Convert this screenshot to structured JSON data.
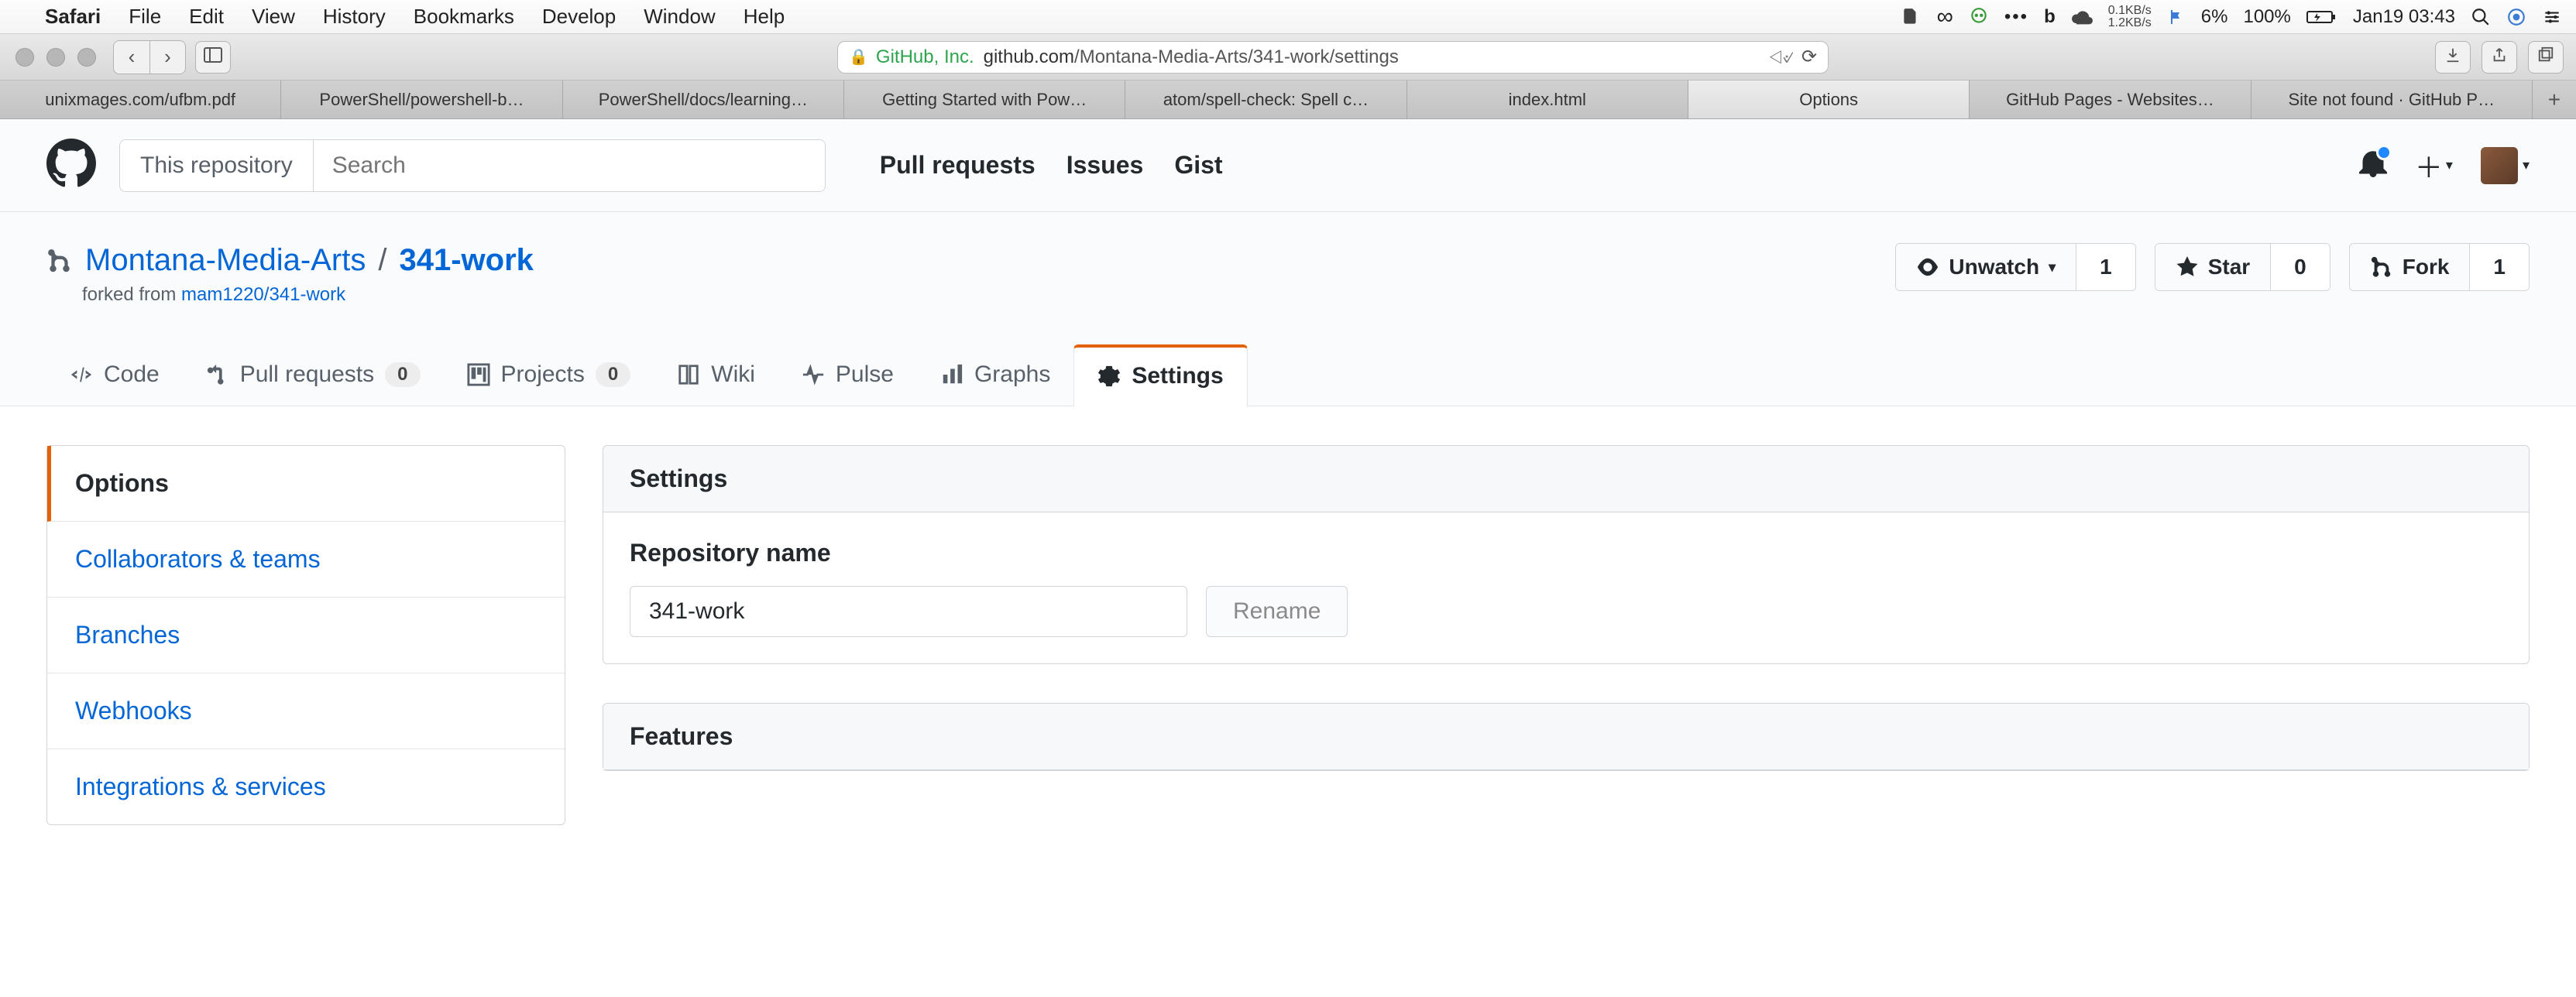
{
  "mac_menubar": {
    "app": "Safari",
    "items": [
      "File",
      "Edit",
      "View",
      "History",
      "Bookmarks",
      "Develop",
      "Window",
      "Help"
    ],
    "net_up": "0.1KB/s",
    "net_down": "1.2KB/s",
    "cpu": "6%",
    "battery": "100%",
    "clock": "Jan19 03:43"
  },
  "safari": {
    "url_prefix_secure": "GitHub, Inc.",
    "url_host": "github.com",
    "url_path": "/Montana-Media-Arts/341-work/settings",
    "tabs": [
      "unixmages.com/ufbm.pdf",
      "PowerShell/powershell-b…",
      "PowerShell/docs/learning…",
      "Getting Started with Pow…",
      "atom/spell-check: Spell c…",
      "index.html",
      "Options",
      "GitHub Pages - Websites…",
      "Site not found · GitHub P…"
    ],
    "active_tab_index": 6
  },
  "github": {
    "search_scope": "This repository",
    "search_placeholder": "Search",
    "nav": [
      "Pull requests",
      "Issues",
      "Gist"
    ]
  },
  "repo": {
    "owner": "Montana-Media-Arts",
    "name": "341-work",
    "forked_prefix": "forked from ",
    "forked_from": "mam1220/341-work",
    "actions": {
      "watch_label": "Unwatch",
      "watch_count": "1",
      "star_label": "Star",
      "star_count": "0",
      "fork_label": "Fork",
      "fork_count": "1"
    },
    "tabs": {
      "code": "Code",
      "pr": "Pull requests",
      "pr_count": "0",
      "projects": "Projects",
      "projects_count": "0",
      "wiki": "Wiki",
      "pulse": "Pulse",
      "graphs": "Graphs",
      "settings": "Settings"
    }
  },
  "sidebar": {
    "items": [
      "Options",
      "Collaborators & teams",
      "Branches",
      "Webhooks",
      "Integrations & services"
    ],
    "active_index": 0
  },
  "settings_panel": {
    "title": "Settings",
    "repo_name_label": "Repository name",
    "repo_name_value": "341-work",
    "rename_btn": "Rename",
    "features_title": "Features"
  }
}
